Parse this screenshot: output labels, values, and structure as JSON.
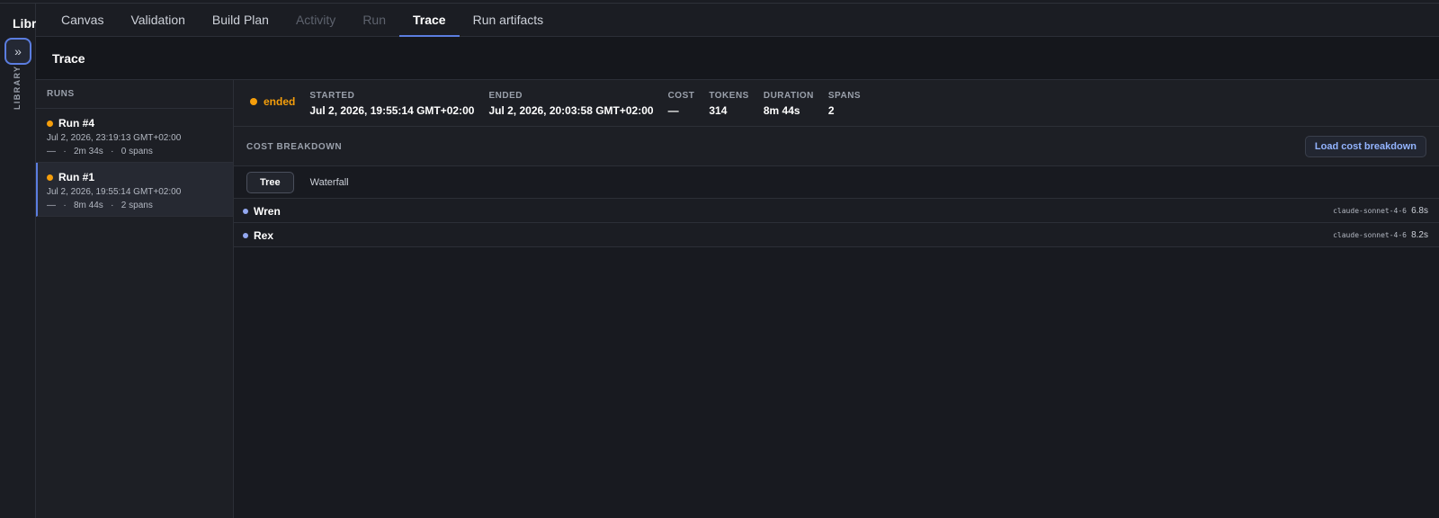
{
  "library": {
    "title": "Libr",
    "toggle_glyph": "»",
    "toggle_icon": "double-chevron-right-icon",
    "label": "LIBRARY"
  },
  "tabs": [
    {
      "label": "Canvas",
      "state": "normal"
    },
    {
      "label": "Validation",
      "state": "normal"
    },
    {
      "label": "Build Plan",
      "state": "normal"
    },
    {
      "label": "Activity",
      "state": "disabled"
    },
    {
      "label": "Run",
      "state": "disabled"
    },
    {
      "label": "Trace",
      "state": "active"
    },
    {
      "label": "Run artifacts",
      "state": "normal"
    }
  ],
  "page": {
    "title": "Trace"
  },
  "runs": {
    "header": "RUNS",
    "items": [
      {
        "name": "Run #4",
        "date": "Jul 2, 2026, 23:19:13 GMT+02:00",
        "cost": "—",
        "duration": "2m 34s",
        "spans": "0 spans",
        "selected": false
      },
      {
        "name": "Run #1",
        "date": "Jul 2, 2026, 19:55:14 GMT+02:00",
        "cost": "—",
        "duration": "8m 44s",
        "spans": "2 spans",
        "selected": true
      }
    ]
  },
  "summary": {
    "status": "ended",
    "status_color": "#f59e0b",
    "stats": [
      {
        "label": "STARTED",
        "value": "Jul 2, 2026, 19:55:14 GMT+02:00"
      },
      {
        "label": "ENDED",
        "value": "Jul 2, 2026, 20:03:58 GMT+02:00"
      },
      {
        "label": "COST",
        "value": "—"
      },
      {
        "label": "TOKENS",
        "value": "314"
      },
      {
        "label": "DURATION",
        "value": "8m 44s"
      },
      {
        "label": "SPANS",
        "value": "2"
      }
    ]
  },
  "cost_breakdown": {
    "title": "COST BREAKDOWN",
    "button": "Load cost breakdown"
  },
  "view_toggle": {
    "options": [
      {
        "label": "Tree",
        "active": true
      },
      {
        "label": "Waterfall",
        "active": false
      }
    ]
  },
  "spans": [
    {
      "name": "Wren",
      "model": "claude-sonnet-4-6",
      "duration": "6.8s"
    },
    {
      "name": "Rex",
      "model": "claude-sonnet-4-6",
      "duration": "8.2s"
    }
  ],
  "colors": {
    "accent": "#5b7de0",
    "status_running": "#f59e0b",
    "span_dot": "#93a8f0",
    "link": "#93b4ff"
  }
}
